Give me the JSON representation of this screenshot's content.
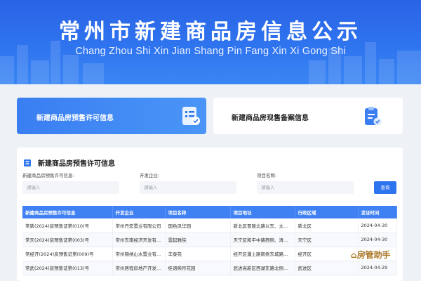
{
  "banner": {
    "title": "常州市新建商品房信息公示",
    "subtitle": "Chang Zhou Shi Xin Jian Shang Pin Fang Xin Xi Gong Shi"
  },
  "cards": {
    "presale_label": "新建商品房预售许可信息",
    "record_label": "新建商品房现售备案信息"
  },
  "panel": {
    "title": "新建商品房预售许可信息",
    "fields": {
      "permit_label": "新建商品房预售许可信息:",
      "permit_placeholder": "请输入",
      "company_label": "开发企业:",
      "company_placeholder": "请输入",
      "project_label": "项目名称:",
      "project_placeholder": "请输入"
    },
    "search_label": "查询"
  },
  "table": {
    "headers": [
      "新建商品房预售许可信息",
      "开发企业",
      "项目名称",
      "项目地址",
      "行政区域",
      "发证时间"
    ],
    "rows": [
      [
        "常新(2024)房预售证第(010)号",
        "常州丹宏置业有限公司",
        "国色风华园",
        "新北区晋陵北路以东、太...",
        "新北区",
        "2024-04-30"
      ],
      [
        "常天(2024)房预售证第(003)号",
        "常州东南经济开发有...",
        "雲起雅院",
        "天宁区和平中路西侧、清...",
        "天宁区",
        "2024-04-30"
      ],
      [
        "常经开(2024)房预售证第(009)号",
        "常州锦绣山水置业有...",
        "丰泰苑",
        "经开区潘上路南侧东城路...",
        "经开区",
        "2024-04-30"
      ],
      [
        "常武(2024)房预售证第(013)号",
        "常州居程房地产开发...",
        "桂语映月花园",
        "武进高新区西湖东路北侧...",
        "武进区",
        "2024-04-29"
      ]
    ]
  },
  "watermark": "房管助手",
  "colors": {
    "accent": "#2f74ef",
    "header_blue": "#3f80f3"
  }
}
